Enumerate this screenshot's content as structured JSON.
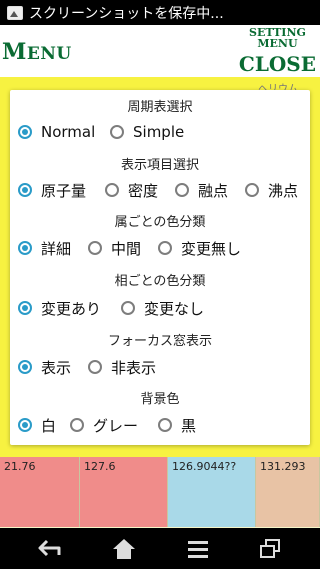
{
  "status_bar": {
    "notification_icon": "image-icon",
    "text": "スクリーンショットを保存中..."
  },
  "app": {
    "menu_title_first": "M",
    "menu_title_rest": "ENU",
    "setting_line1": "SETTING",
    "setting_line2": "MENU",
    "close_label": "CLOSE",
    "helium_label": "ヘリウム",
    "grid_cells": [
      "21.76",
      "127.6",
      "126.9044??",
      "131.293"
    ]
  },
  "dialog": {
    "sections": [
      {
        "title": "周期表選択",
        "options": [
          {
            "label": "Normal",
            "checked": true
          },
          {
            "label": "Simple",
            "checked": false
          }
        ]
      },
      {
        "title": "表示項目選択",
        "options": [
          {
            "label": "原子量",
            "checked": true
          },
          {
            "label": "密度",
            "checked": false
          },
          {
            "label": "融点",
            "checked": false
          },
          {
            "label": "沸点",
            "checked": false
          }
        ]
      },
      {
        "title": "属ごとの色分類",
        "options": [
          {
            "label": "詳細",
            "checked": true
          },
          {
            "label": "中間",
            "checked": false
          },
          {
            "label": "変更無し",
            "checked": false
          }
        ]
      },
      {
        "title": "相ごとの色分類",
        "options": [
          {
            "label": "変更あり",
            "checked": true
          },
          {
            "label": "変更なし",
            "checked": false
          }
        ]
      },
      {
        "title": "フォーカス窓表示",
        "options": [
          {
            "label": "表示",
            "checked": true
          },
          {
            "label": "非表示",
            "checked": false
          }
        ]
      },
      {
        "title": "背景色",
        "options": [
          {
            "label": "白",
            "checked": true
          },
          {
            "label": "グレー",
            "checked": false
          },
          {
            "label": "黒",
            "checked": false
          }
        ]
      }
    ]
  },
  "nav_bar": {
    "buttons": [
      "back-icon",
      "home-icon",
      "menu-icon",
      "recent-apps-icon"
    ]
  },
  "colors": {
    "accent_blue": "#2a9bc8",
    "menu_green": "#0a6b33",
    "background_yellow": "#f7f241"
  }
}
